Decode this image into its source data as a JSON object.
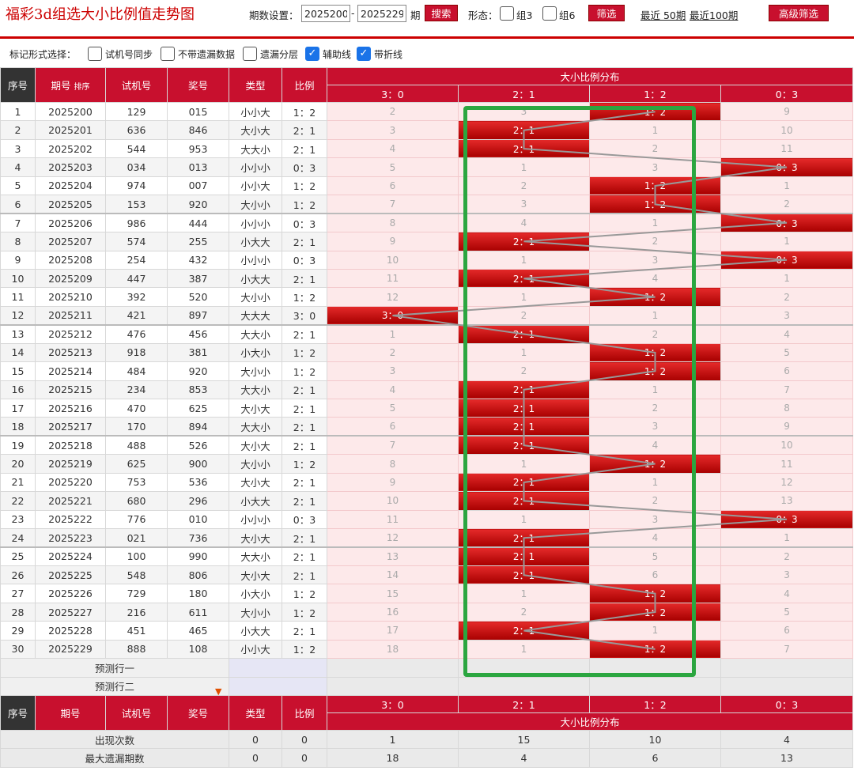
{
  "top": {
    "title": "福彩3d组选大小比例值走势图",
    "period_label": "期数设置：",
    "from": "2025200",
    "dash": "-",
    "to": "2025229",
    "period_unit": "期",
    "search": "搜索",
    "form_label": "形态：",
    "form1": "组3",
    "form2": "组6",
    "filter": "筛选",
    "recent50": "最近 50期",
    "recent100": "最近100期",
    "advanced": "高级筛选"
  },
  "options": {
    "label": "标记形式选择：",
    "items": [
      {
        "label": "试机号同步",
        "checked": false
      },
      {
        "label": "不带遗漏数据",
        "checked": false
      },
      {
        "label": "遗漏分层",
        "checked": false
      },
      {
        "label": "辅助线",
        "checked": true
      },
      {
        "label": "带折线",
        "checked": true
      }
    ]
  },
  "header": {
    "seq": "序号",
    "issue": "期号",
    "sort": "排序",
    "test": "试机号",
    "prize": "奖号",
    "type": "类型",
    "ratio": "比例",
    "dist": "大小比例分布",
    "cols": [
      "3：0",
      "2：1",
      "1：2",
      "0：3"
    ]
  },
  "rows": [
    {
      "seq": "1",
      "issue": "2025200",
      "test": "129",
      "prize": "015",
      "type": "小小大",
      "ratio": "1：2",
      "dist": [
        "2",
        "3",
        "1：2",
        "9"
      ]
    },
    {
      "seq": "2",
      "issue": "2025201",
      "test": "636",
      "prize": "846",
      "type": "大小大",
      "ratio": "2：1",
      "dist": [
        "3",
        "2：1",
        "1",
        "10"
      ]
    },
    {
      "seq": "3",
      "issue": "2025202",
      "test": "544",
      "prize": "953",
      "type": "大大小",
      "ratio": "2：1",
      "dist": [
        "4",
        "2：1",
        "2",
        "11"
      ]
    },
    {
      "seq": "4",
      "issue": "2025203",
      "test": "034",
      "prize": "013",
      "type": "小小小",
      "ratio": "0：3",
      "dist": [
        "5",
        "1",
        "3",
        "0：3"
      ]
    },
    {
      "seq": "5",
      "issue": "2025204",
      "test": "974",
      "prize": "007",
      "type": "小小大",
      "ratio": "1：2",
      "dist": [
        "6",
        "2",
        "1：2",
        "1"
      ]
    },
    {
      "seq": "6",
      "issue": "2025205",
      "test": "153",
      "prize": "920",
      "type": "大小小",
      "ratio": "1：2",
      "dist": [
        "7",
        "3",
        "1：2",
        "2"
      ]
    },
    {
      "seq": "7",
      "issue": "2025206",
      "test": "986",
      "prize": "444",
      "type": "小小小",
      "ratio": "0：3",
      "dist": [
        "8",
        "4",
        "1",
        "0：3"
      ]
    },
    {
      "seq": "8",
      "issue": "2025207",
      "test": "574",
      "prize": "255",
      "type": "小大大",
      "ratio": "2：1",
      "dist": [
        "9",
        "2：1",
        "2",
        "1"
      ]
    },
    {
      "seq": "9",
      "issue": "2025208",
      "test": "254",
      "prize": "432",
      "type": "小小小",
      "ratio": "0：3",
      "dist": [
        "10",
        "1",
        "3",
        "0：3"
      ]
    },
    {
      "seq": "10",
      "issue": "2025209",
      "test": "447",
      "prize": "387",
      "type": "小大大",
      "ratio": "2：1",
      "dist": [
        "11",
        "2：1",
        "4",
        "1"
      ]
    },
    {
      "seq": "11",
      "issue": "2025210",
      "test": "392",
      "prize": "520",
      "type": "大小小",
      "ratio": "1：2",
      "dist": [
        "12",
        "1",
        "1：2",
        "2"
      ]
    },
    {
      "seq": "12",
      "issue": "2025211",
      "test": "421",
      "prize": "897",
      "type": "大大大",
      "ratio": "3：0",
      "dist": [
        "3：0",
        "2",
        "1",
        "3"
      ]
    },
    {
      "seq": "13",
      "issue": "2025212",
      "test": "476",
      "prize": "456",
      "type": "大大小",
      "ratio": "2：1",
      "dist": [
        "1",
        "2：1",
        "2",
        "4"
      ]
    },
    {
      "seq": "14",
      "issue": "2025213",
      "test": "918",
      "prize": "381",
      "type": "小大小",
      "ratio": "1：2",
      "dist": [
        "2",
        "1",
        "1：2",
        "5"
      ]
    },
    {
      "seq": "15",
      "issue": "2025214",
      "test": "484",
      "prize": "920",
      "type": "大小小",
      "ratio": "1：2",
      "dist": [
        "3",
        "2",
        "1：2",
        "6"
      ]
    },
    {
      "seq": "16",
      "issue": "2025215",
      "test": "234",
      "prize": "853",
      "type": "大大小",
      "ratio": "2：1",
      "dist": [
        "4",
        "2：1",
        "1",
        "7"
      ]
    },
    {
      "seq": "17",
      "issue": "2025216",
      "test": "470",
      "prize": "625",
      "type": "大小大",
      "ratio": "2：1",
      "dist": [
        "5",
        "2：1",
        "2",
        "8"
      ]
    },
    {
      "seq": "18",
      "issue": "2025217",
      "test": "170",
      "prize": "894",
      "type": "大大小",
      "ratio": "2：1",
      "dist": [
        "6",
        "2：1",
        "3",
        "9"
      ]
    },
    {
      "seq": "19",
      "issue": "2025218",
      "test": "488",
      "prize": "526",
      "type": "大小大",
      "ratio": "2：1",
      "dist": [
        "7",
        "2：1",
        "4",
        "10"
      ]
    },
    {
      "seq": "20",
      "issue": "2025219",
      "test": "625",
      "prize": "900",
      "type": "大小小",
      "ratio": "1：2",
      "dist": [
        "8",
        "1",
        "1：2",
        "11"
      ]
    },
    {
      "seq": "21",
      "issue": "2025220",
      "test": "753",
      "prize": "536",
      "type": "大小大",
      "ratio": "2：1",
      "dist": [
        "9",
        "2：1",
        "1",
        "12"
      ]
    },
    {
      "seq": "22",
      "issue": "2025221",
      "test": "680",
      "prize": "296",
      "type": "小大大",
      "ratio": "2：1",
      "dist": [
        "10",
        "2：1",
        "2",
        "13"
      ]
    },
    {
      "seq": "23",
      "issue": "2025222",
      "test": "776",
      "prize": "010",
      "type": "小小小",
      "ratio": "0：3",
      "dist": [
        "11",
        "1",
        "3",
        "0：3"
      ]
    },
    {
      "seq": "24",
      "issue": "2025223",
      "test": "021",
      "prize": "736",
      "type": "大小大",
      "ratio": "2：1",
      "dist": [
        "12",
        "2：1",
        "4",
        "1"
      ]
    },
    {
      "seq": "25",
      "issue": "2025224",
      "test": "100",
      "prize": "990",
      "type": "大大小",
      "ratio": "2：1",
      "dist": [
        "13",
        "2：1",
        "5",
        "2"
      ]
    },
    {
      "seq": "26",
      "issue": "2025225",
      "test": "548",
      "prize": "806",
      "type": "大小大",
      "ratio": "2：1",
      "dist": [
        "14",
        "2：1",
        "6",
        "3"
      ]
    },
    {
      "seq": "27",
      "issue": "2025226",
      "test": "729",
      "prize": "180",
      "type": "小大小",
      "ratio": "1：2",
      "dist": [
        "15",
        "1",
        "1：2",
        "4"
      ]
    },
    {
      "seq": "28",
      "issue": "2025227",
      "test": "216",
      "prize": "611",
      "type": "大小小",
      "ratio": "1：2",
      "dist": [
        "16",
        "2",
        "1：2",
        "5"
      ]
    },
    {
      "seq": "29",
      "issue": "2025228",
      "test": "451",
      "prize": "465",
      "type": "小大大",
      "ratio": "2：1",
      "dist": [
        "17",
        "2：1",
        "1",
        "6"
      ]
    },
    {
      "seq": "30",
      "issue": "2025229",
      "test": "888",
      "prize": "108",
      "type": "小小大",
      "ratio": "1：2",
      "dist": [
        "18",
        "1",
        "1：2",
        "7"
      ]
    }
  ],
  "hit_col": [
    2,
    1,
    1,
    3,
    2,
    2,
    3,
    1,
    3,
    1,
    2,
    0,
    1,
    2,
    2,
    1,
    1,
    1,
    1,
    2,
    1,
    1,
    3,
    1,
    1,
    1,
    2,
    2,
    1,
    2
  ],
  "predict": [
    "预测行一",
    "预测行二"
  ],
  "stats": [
    {
      "label": "出现次数",
      "type": "0",
      "ratio": "0",
      "vals": [
        "1",
        "15",
        "10",
        "4"
      ]
    },
    {
      "label": "最大遗漏期数",
      "type": "0",
      "ratio": "0",
      "vals": [
        "18",
        "4",
        "6",
        "13"
      ]
    }
  ],
  "colors": {
    "accent": "#c8102e",
    "highlight_box": "#2ba640",
    "line": "#999999"
  }
}
